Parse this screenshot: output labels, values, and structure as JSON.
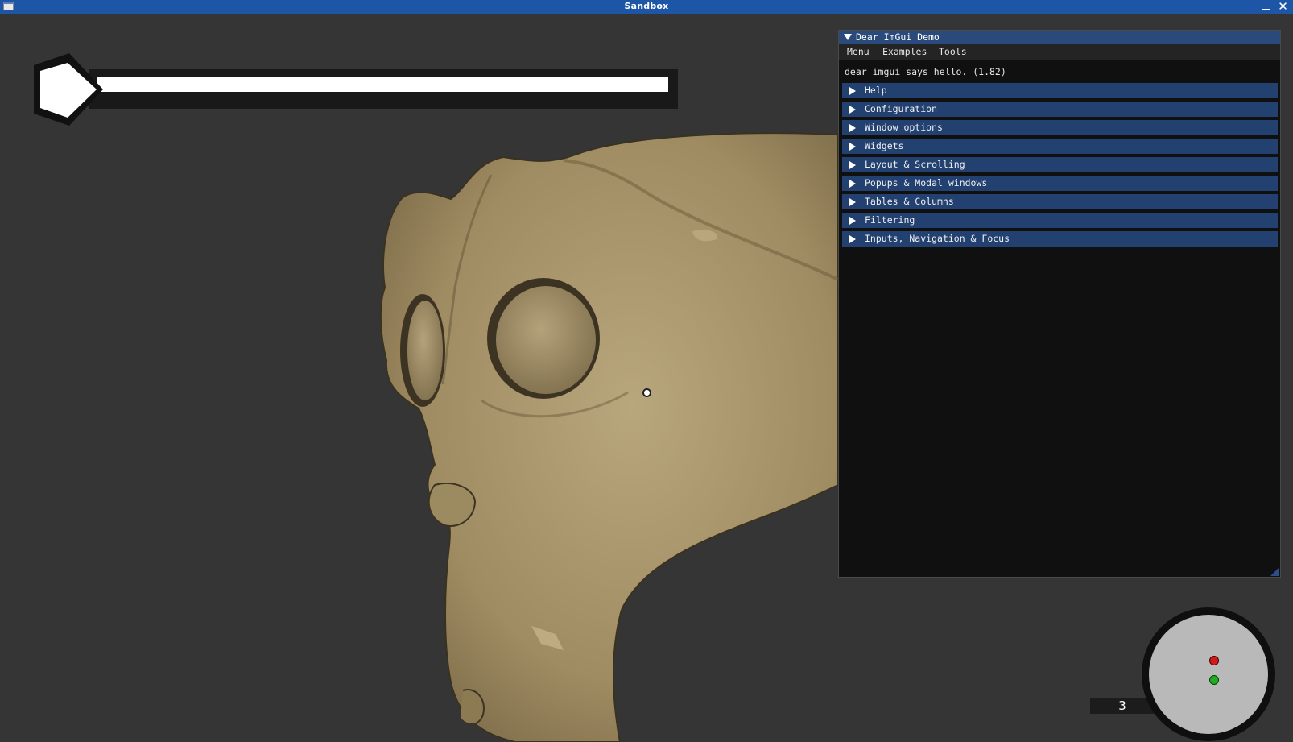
{
  "window": {
    "title": "Sandbox"
  },
  "hud": {
    "health_fraction": 1.0,
    "ammo_count": "3"
  },
  "imgui": {
    "title": "Dear ImGui Demo",
    "menu": [
      "Menu",
      "Examples",
      "Tools"
    ],
    "hello_text": "dear imgui says hello. (1.82)",
    "headers": [
      "Help",
      "Configuration",
      "Window options",
      "Widgets",
      "Layout & Scrolling",
      "Popups & Modal windows",
      "Tables & Columns",
      "Filtering",
      "Inputs, Navigation & Focus"
    ]
  },
  "colors": {
    "titlebar": "#1d56a6",
    "viewport_bg": "#353535",
    "skin": "#a89468",
    "imgui_header": "#234170",
    "radar_enemy": "#d11a1a",
    "radar_player": "#22aa22"
  }
}
